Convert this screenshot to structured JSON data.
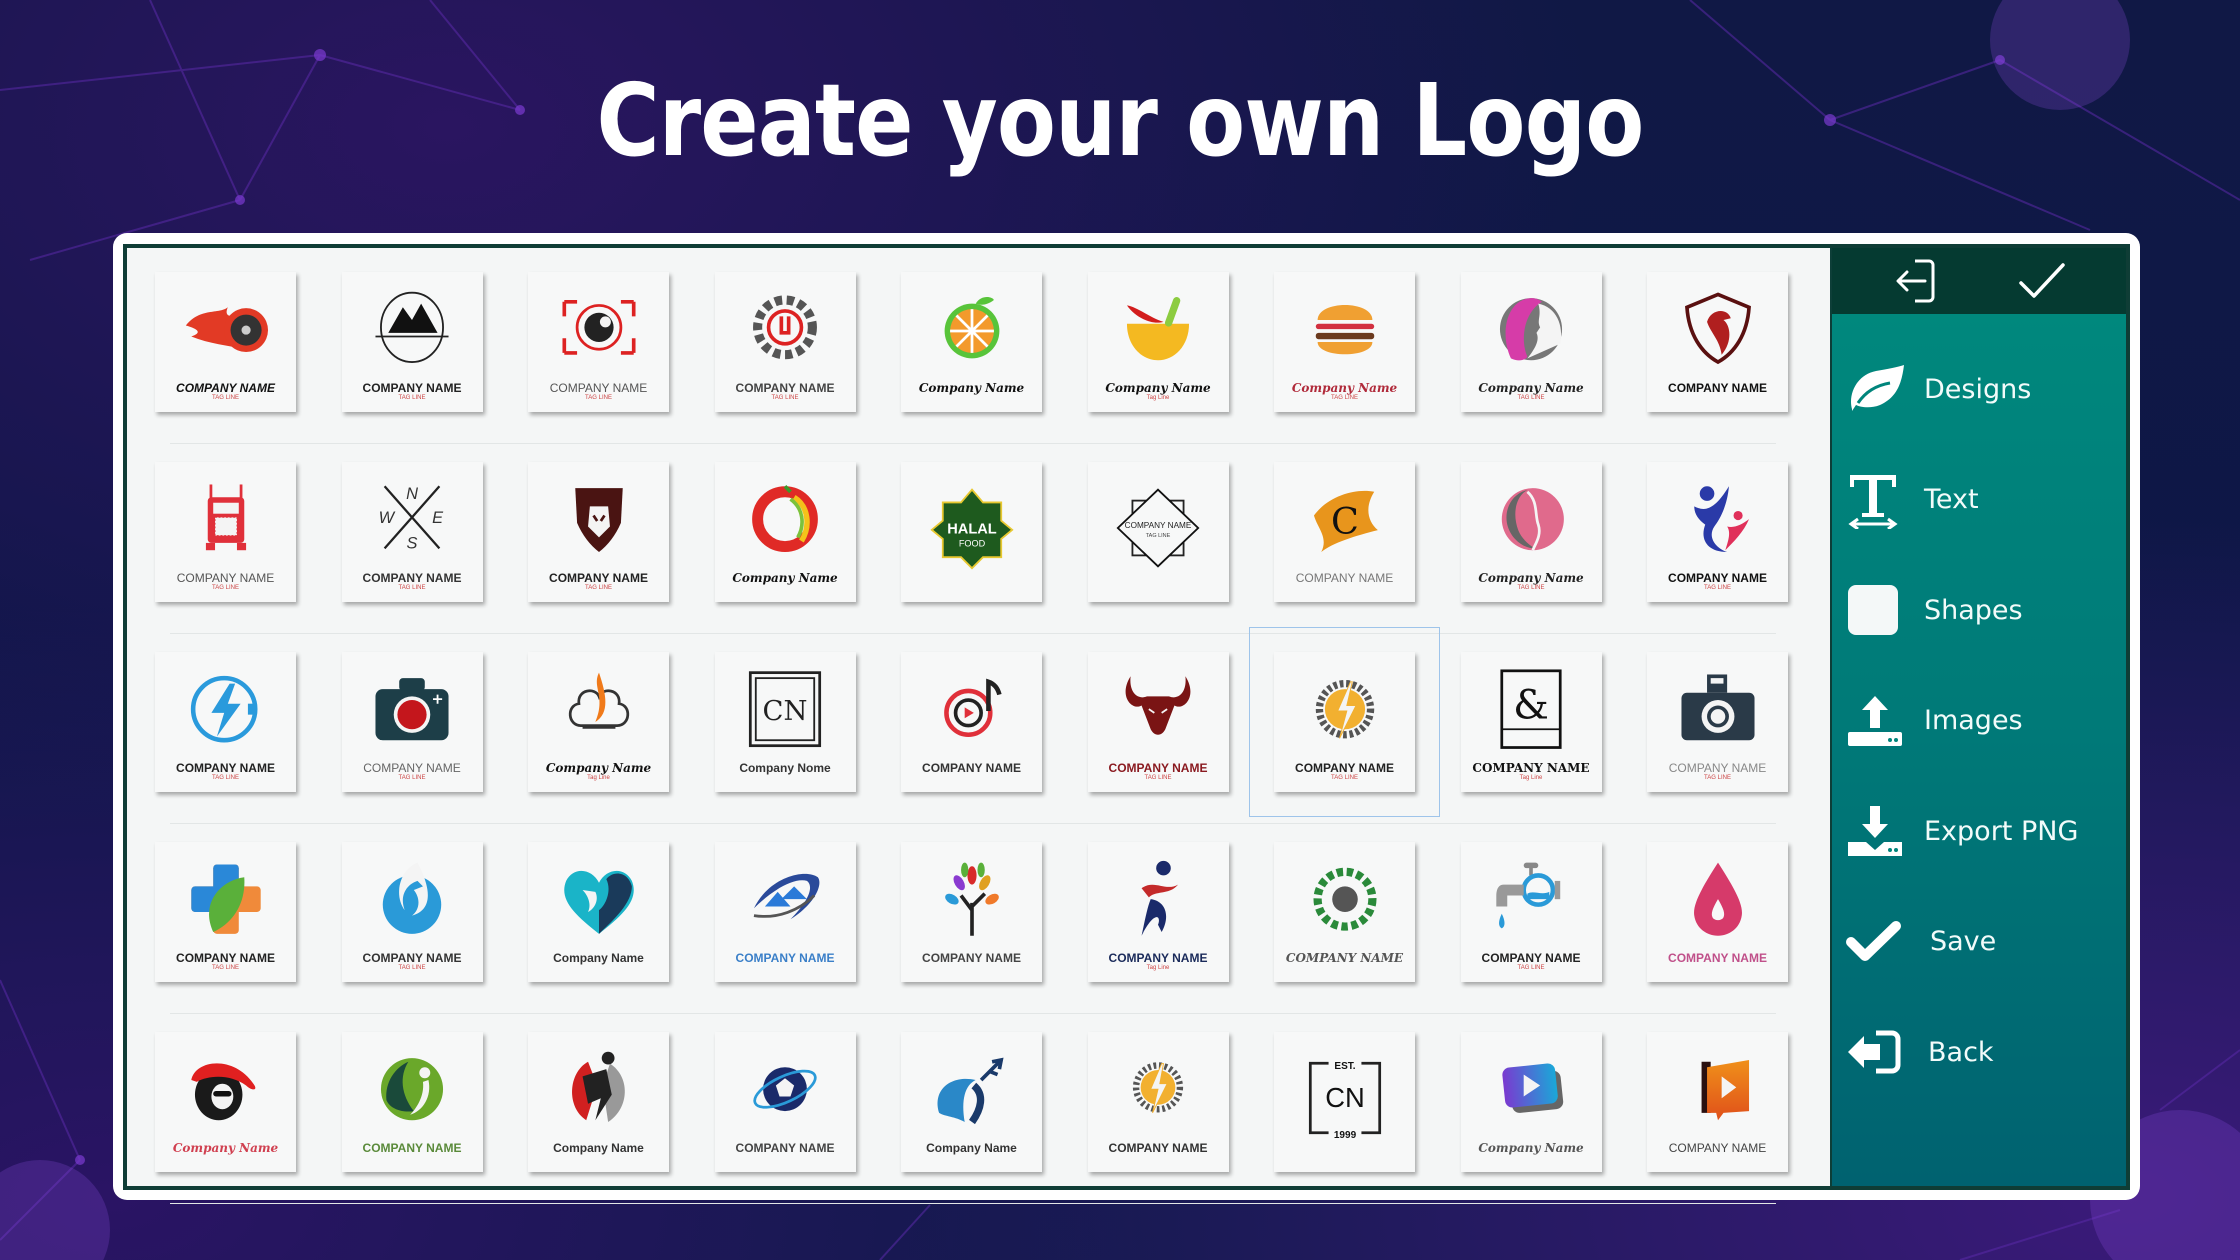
{
  "headline": "Create your own Logo",
  "colors": {
    "background": "#101845",
    "accent_purple": "#6a2fb8",
    "sidebar_teal": "#00857c",
    "sidebar_header": "#053a31",
    "frame_border": "#0f3d36"
  },
  "sidebar": {
    "top_actions": [
      {
        "icon": "exit-icon",
        "label": "Exit"
      },
      {
        "icon": "checkmark-icon",
        "label": "Confirm"
      }
    ],
    "items": [
      {
        "icon": "leaf-icon",
        "label": "Designs"
      },
      {
        "icon": "text-icon",
        "label": "Text"
      },
      {
        "icon": "square-icon",
        "label": "Shapes"
      },
      {
        "icon": "upload-icon",
        "label": "Images"
      },
      {
        "icon": "download-icon",
        "label": "Export PNG"
      },
      {
        "icon": "check-icon",
        "label": "Save"
      },
      {
        "icon": "back-icon",
        "label": "Back"
      }
    ]
  },
  "logo_grid": {
    "rows": [
      [
        {
          "mark": "flaming-wheel",
          "name": "COMPANY NAME",
          "tag": "TAG LINE",
          "color": "#111111",
          "style": "bold-italic"
        },
        {
          "mark": "mountain-badge",
          "name": "COMPANY NAME",
          "tag": "TAG LINE",
          "color": "#222222",
          "style": "condensed"
        },
        {
          "mark": "camera-lens-frame",
          "name": "COMPANY NAME",
          "tag": "TAG LINE",
          "color": "#555555",
          "style": "thin"
        },
        {
          "mark": "gear-wrench",
          "name": "COMPANY NAME",
          "tag": "TAG LINE",
          "color": "#444444",
          "style": "condensed"
        },
        {
          "mark": "orange-slice",
          "name": "Company Name",
          "tag": "",
          "color": "#111111",
          "style": "script"
        },
        {
          "mark": "chili-mortar",
          "name": "Company Name",
          "tag": "Tag Line",
          "color": "#111111",
          "style": "script"
        },
        {
          "mark": "burger",
          "name": "Company Name",
          "tag": "TAG LINE",
          "color": "#b02a3a",
          "style": "script"
        },
        {
          "mark": "woman-hair-purple",
          "name": "Company Name",
          "tag": "TAG LINE",
          "color": "#222222",
          "style": "script"
        },
        {
          "mark": "eagle-shield",
          "name": "COMPANY NAME",
          "tag": "",
          "color": "#111111",
          "style": "bold"
        }
      ],
      [
        {
          "mark": "red-truck",
          "name": "COMPANY NAME",
          "tag": "TAG LINE",
          "color": "#555555",
          "style": "thin"
        },
        {
          "mark": "compass-cross",
          "name": "COMPANY NAME",
          "tag": "TAG LINE",
          "color": "#333333",
          "style": "condensed"
        },
        {
          "mark": "lion-head",
          "name": "COMPANY NAME",
          "tag": "TAG LINE",
          "color": "#222222",
          "style": "condensed"
        },
        {
          "mark": "chili-ring",
          "name": "Company Name",
          "tag": "",
          "color": "#111111",
          "style": "script"
        },
        {
          "mark": "halal-food-star",
          "name": "",
          "tag": "",
          "color": "#1e5a1e",
          "style": "bold"
        },
        {
          "mark": "diamond-frame",
          "name": "",
          "tag": "",
          "color": "#222222",
          "style": "condensed"
        },
        {
          "mark": "brush-c",
          "name": "COMPANY NAME",
          "tag": "",
          "color": "#777777",
          "style": "thin"
        },
        {
          "mark": "woman-hair-pink",
          "name": "Company Name",
          "tag": "TAG LINE",
          "color": "#222222",
          "style": "script"
        },
        {
          "mark": "people-figures",
          "name": "COMPANY NAME",
          "tag": "TAG LINE",
          "color": "#111111",
          "style": "bold"
        }
      ],
      [
        {
          "mark": "lightning-plug",
          "name": "COMPANY NAME",
          "tag": "TAG LINE",
          "color": "#222222",
          "style": "bold"
        },
        {
          "mark": "dark-camera",
          "name": "COMPANY NAME",
          "tag": "TAG LINE",
          "color": "#666666",
          "style": "thin"
        },
        {
          "mark": "chef-hat-flame",
          "name": "Company Name",
          "tag": "Tag Line",
          "color": "#111111",
          "style": "script"
        },
        {
          "mark": "cn-square",
          "name": "Company Nome",
          "tag": "",
          "color": "#333333",
          "style": "bold"
        },
        {
          "mark": "music-play",
          "name": "COMPANY NAME",
          "tag": "",
          "color": "#333333",
          "style": "bold"
        },
        {
          "mark": "bull-head",
          "name": "COMPANY NAME",
          "tag": "TAG LINE",
          "color": "#8a1a20",
          "style": "condensed"
        },
        {
          "mark": "gear-lightning",
          "name": "COMPANY NAME",
          "tag": "TAG LINE",
          "color": "#222222",
          "style": "bold"
        },
        {
          "mark": "ampersand-box",
          "name": "COMPANY NAME",
          "tag": "Tag Line",
          "color": "#111111",
          "style": "serif"
        },
        {
          "mark": "retro-camera",
          "name": "COMPANY NAME",
          "tag": "TAG LINE",
          "color": "#888888",
          "style": "thin"
        }
      ],
      [
        {
          "mark": "medical-leaf-cross",
          "name": "COMPANY NAME",
          "tag": "TAG LINE",
          "color": "#222222",
          "style": "bold"
        },
        {
          "mark": "blue-phoenix",
          "name": "COMPANY NAME",
          "tag": "TAG LINE",
          "color": "#333333",
          "style": "condensed"
        },
        {
          "mark": "heart-faces",
          "name": "Company Name",
          "tag": "",
          "color": "#333333",
          "style": "condensed"
        },
        {
          "mark": "house-swoosh",
          "name": "COMPANY NAME",
          "tag": "",
          "color": "#3a7fc8",
          "style": "condensed"
        },
        {
          "mark": "colorful-tree",
          "name": "COMPANY NAME",
          "tag": "",
          "color": "#444444",
          "style": "condensed"
        },
        {
          "mark": "runner",
          "name": "COMPANY NAME",
          "tag": "Tag Line",
          "color": "#1a2a5a",
          "style": "bold"
        },
        {
          "mark": "green-gear",
          "name": "COMPANY NAME",
          "tag": "",
          "color": "#555555",
          "style": "script"
        },
        {
          "mark": "water-tap",
          "name": "COMPANY NAME",
          "tag": "TAG LINE",
          "color": "#222222",
          "style": "bold"
        },
        {
          "mark": "red-drop",
          "name": "COMPANY NAME",
          "tag": "",
          "color": "#c0508a",
          "style": "bold"
        }
      ],
      [
        {
          "mark": "lady-red-hat",
          "name": "Company Name",
          "tag": "",
          "color": "#d04050",
          "style": "script"
        },
        {
          "mark": "green-leaf-person",
          "name": "COMPANY NAME",
          "tag": "",
          "color": "#5a8a3a",
          "style": "condensed"
        },
        {
          "mark": "soccer-player",
          "name": "Company Name",
          "tag": "",
          "color": "#333333",
          "style": "condensed"
        },
        {
          "mark": "soccer-ball-orbit",
          "name": "COMPANY NAME",
          "tag": "",
          "color": "#444444",
          "style": "condensed"
        },
        {
          "mark": "plane-swoosh",
          "name": "Company Name",
          "tag": "",
          "color": "#333333",
          "style": "condensed"
        },
        {
          "mark": "gear-lightning-small",
          "name": "COMPANY NAME",
          "tag": "",
          "color": "#333333",
          "style": "condensed"
        },
        {
          "mark": "est-cn-1999",
          "name": "",
          "tag": "",
          "color": "#111111",
          "style": "bold"
        },
        {
          "mark": "video-play-gradient",
          "name": "Company Name",
          "tag": "",
          "color": "#555555",
          "style": "script"
        },
        {
          "mark": "orange-play-book",
          "name": "COMPANY NAME",
          "tag": "",
          "color": "#444444",
          "style": "thin"
        }
      ]
    ],
    "text_overlays": {
      "halal_top": "HALAL",
      "halal_bottom": "FOOD",
      "diamond_name": "COMPANY NAME",
      "diamond_tag": "TAG LINE",
      "cn_letters": "CN",
      "est": "EST.",
      "year": "1999",
      "brush_letter": "C",
      "ampersand": "&"
    }
  }
}
